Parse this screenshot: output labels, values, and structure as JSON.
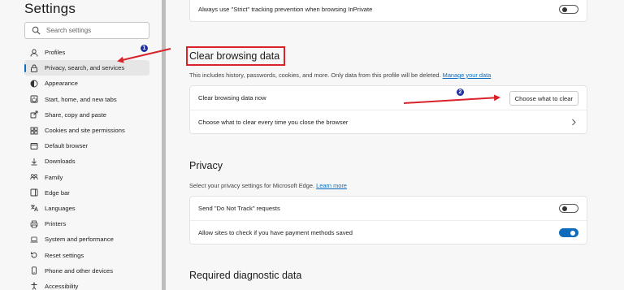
{
  "sidebar": {
    "title": "Settings",
    "search_placeholder": "Search settings",
    "items": [
      {
        "label": "Profiles",
        "icon": "profile-icon"
      },
      {
        "label": "Privacy, search, and services",
        "icon": "lock-icon",
        "active": true
      },
      {
        "label": "Appearance",
        "icon": "appearance-icon"
      },
      {
        "label": "Start, home, and new tabs",
        "icon": "power-icon"
      },
      {
        "label": "Share, copy and paste",
        "icon": "share-icon"
      },
      {
        "label": "Cookies and site permissions",
        "icon": "cookie-grid-icon"
      },
      {
        "label": "Default browser",
        "icon": "browser-icon"
      },
      {
        "label": "Downloads",
        "icon": "download-icon"
      },
      {
        "label": "Family",
        "icon": "family-icon"
      },
      {
        "label": "Edge bar",
        "icon": "edge-bar-icon"
      },
      {
        "label": "Languages",
        "icon": "languages-icon"
      },
      {
        "label": "Printers",
        "icon": "printer-icon"
      },
      {
        "label": "System and performance",
        "icon": "laptop-icon"
      },
      {
        "label": "Reset settings",
        "icon": "reset-icon"
      },
      {
        "label": "Phone and other devices",
        "icon": "phone-icon"
      },
      {
        "label": "Accessibility",
        "icon": "accessibility-icon"
      }
    ]
  },
  "main": {
    "tracking_row": {
      "label": "Always use \"Strict\" tracking prevention when browsing InPrivate",
      "toggle_on": false
    },
    "clear_section": {
      "title": "Clear browsing data",
      "description": "This includes history, passwords, cookies, and more. Only data from this profile will be deleted.",
      "link": "Manage your data",
      "rows": [
        {
          "label": "Clear browsing data now",
          "button": "Choose what to clear"
        },
        {
          "label": "Choose what to clear every time you close the browser"
        }
      ]
    },
    "privacy_section": {
      "title": "Privacy",
      "description": "Select your privacy settings for Microsoft Edge.",
      "link": "Learn more",
      "rows": [
        {
          "label": "Send \"Do Not Track\" requests",
          "toggle_on": false
        },
        {
          "label": "Allow sites to check if you have payment methods saved",
          "toggle_on": true
        }
      ]
    },
    "diagnostic_section": {
      "title": "Required diagnostic data"
    }
  },
  "annotations": {
    "badge_1": "1",
    "badge_2": "2",
    "color": "#d9222a",
    "badge_color": "#1e2fa0"
  },
  "colors": {
    "accent": "#0f6cbd",
    "background": "#f7f7f7"
  }
}
